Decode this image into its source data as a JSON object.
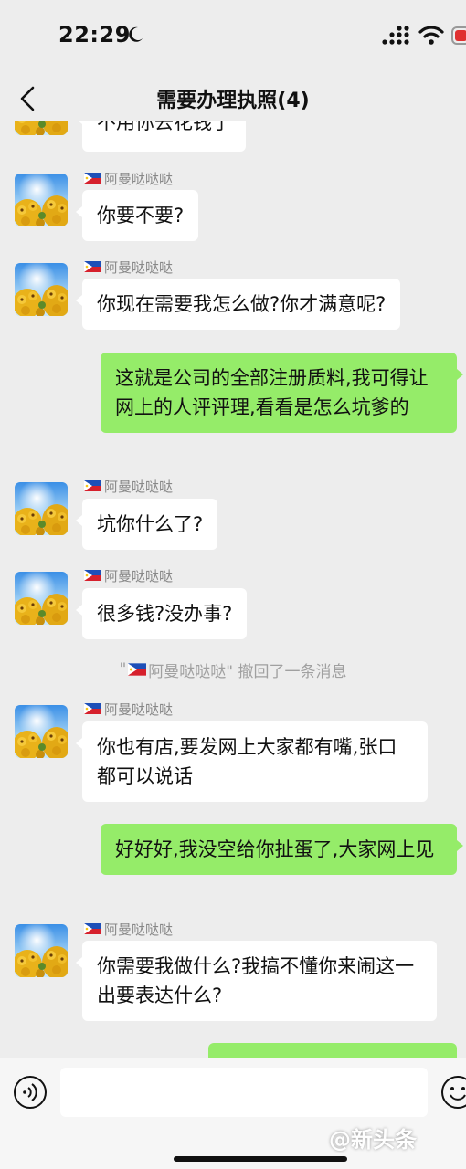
{
  "status_bar": {
    "time": "22:29"
  },
  "nav": {
    "title": "需要办理执照(4)"
  },
  "messages": [
    {
      "side": "in",
      "name": "",
      "text": "不用你去花钱了"
    },
    {
      "side": "in",
      "name": "阿曼哒哒哒",
      "text": "你要不要?"
    },
    {
      "side": "in",
      "name": "阿曼哒哒哒",
      "text": "你现在需要我怎么做?你才满意呢?"
    },
    {
      "side": "out",
      "text": "这就是公司的全部注册质料,我可得让网上的人评评理,看看是怎么坑爹的"
    },
    {
      "side": "in",
      "name": "阿曼哒哒哒",
      "text": "坑你什么了?"
    },
    {
      "side": "in",
      "name": "阿曼哒哒哒",
      "text": "很多钱?没办事?"
    },
    {
      "side": "in",
      "name": "阿曼哒哒哒",
      "text": "你也有店,要发网上大家都有嘴,张口都可以说话"
    },
    {
      "side": "out",
      "text": "好好好,我没空给你扯蛋了,大家网上见"
    },
    {
      "side": "in",
      "name": "阿曼哒哒哒",
      "text": "你需要我做什么?我搞不懂你来闹这一出要表达什么?"
    }
  ],
  "recall_notice": {
    "open_quote": "\"",
    "name": "阿曼哒哒哒",
    "suffix": "\" 撤回了一条消息"
  },
  "input_bar": {
    "placeholder": ""
  },
  "watermark": "@新头条",
  "colors": {
    "out_bubble": "#95ec69",
    "in_bubble": "#ffffff",
    "background": "#ededed"
  },
  "icons": [
    "back-arrow-icon",
    "moon-icon",
    "signal-icon",
    "wifi-icon",
    "battery-icon",
    "voice-icon",
    "emoji-icon",
    "philippines-flag-icon"
  ]
}
